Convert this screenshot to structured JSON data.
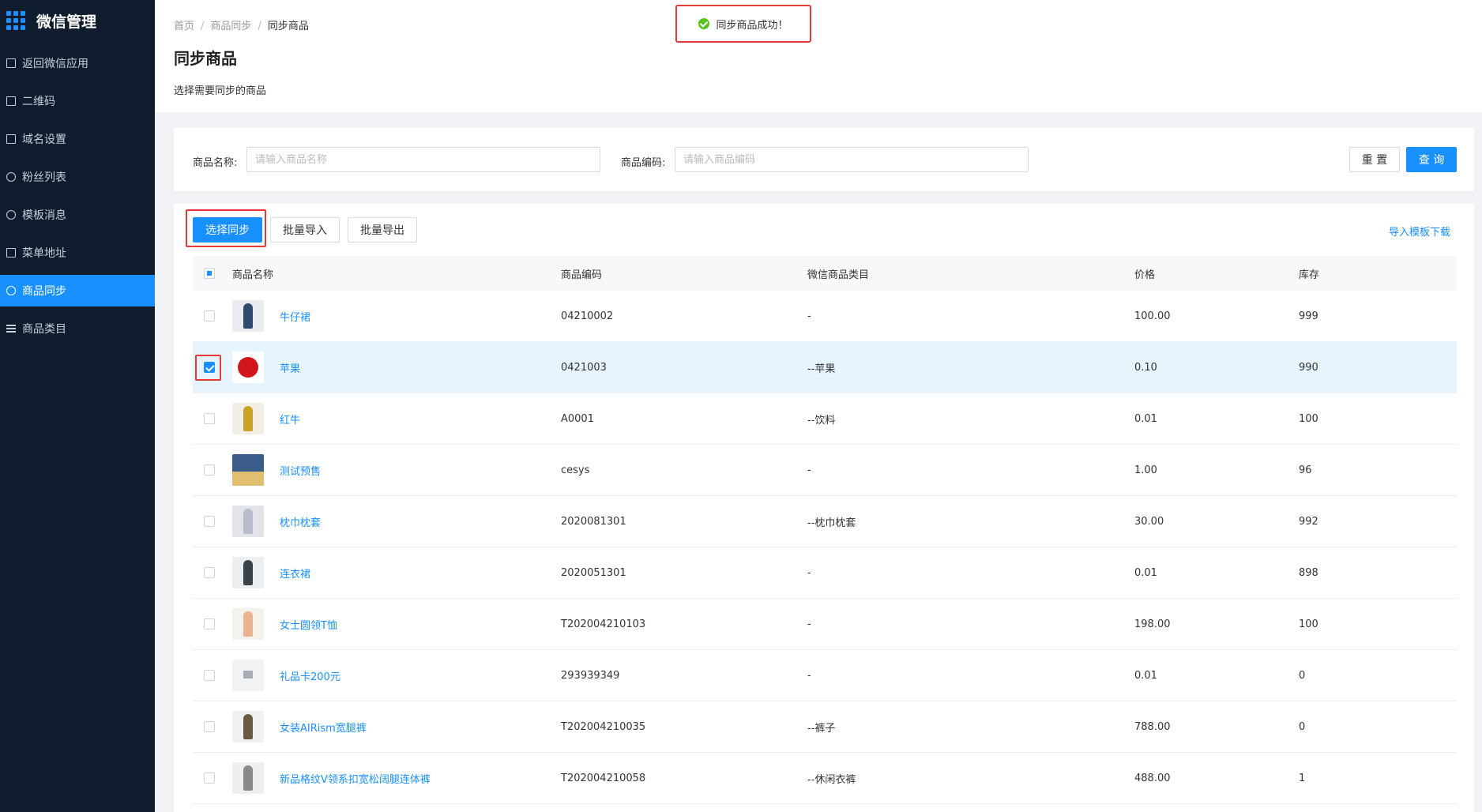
{
  "sidebar": {
    "brand_title": "微信管理",
    "items": [
      {
        "label": "返回微信应用",
        "icon": "return-icon"
      },
      {
        "label": "二维码",
        "icon": "qrcode-icon"
      },
      {
        "label": "域名设置",
        "icon": "domain-icon"
      },
      {
        "label": "粉丝列表",
        "icon": "refresh-icon"
      },
      {
        "label": "模板消息",
        "icon": "message-icon"
      },
      {
        "label": "菜单地址",
        "icon": "menu-check-icon"
      },
      {
        "label": "商品同步",
        "icon": "cloud-icon",
        "active": true
      },
      {
        "label": "商品类目",
        "icon": "list-icon"
      }
    ]
  },
  "header": {
    "breadcrumb": [
      "首页",
      "商品同步",
      "同步商品"
    ],
    "title": "同步商品",
    "description": "选择需要同步的商品"
  },
  "toast": {
    "message": "同步商品成功！"
  },
  "search": {
    "name_label": "商品名称:",
    "name_placeholder": "请输入商品名称",
    "code_label": "商品编码:",
    "code_placeholder": "请输入商品编码",
    "reset_label": "重 置",
    "query_label": "查 询"
  },
  "toolbar": {
    "sync_label": "选择同步",
    "import_label": "批量导入",
    "export_label": "批量导出",
    "download_label": "导入模板下载"
  },
  "table": {
    "headers": {
      "name": "商品名称",
      "code": "商品编码",
      "category": "微信商品类目",
      "price": "价格",
      "stock": "库存"
    },
    "rows": [
      {
        "name": "牛仔裙",
        "code": "04210002",
        "category": "-",
        "price": "100.00",
        "stock": "999",
        "checked": false,
        "thumb": "dress"
      },
      {
        "name": "苹果",
        "code": "0421003",
        "category": "--苹果",
        "price": "0.10",
        "stock": "990",
        "checked": true,
        "thumb": "apple"
      },
      {
        "name": "红牛",
        "code": "A0001",
        "category": "--饮料",
        "price": "0.01",
        "stock": "100",
        "checked": false,
        "thumb": "can"
      },
      {
        "name": "测试预售",
        "code": "cesys",
        "category": "-",
        "price": "1.00",
        "stock": "96",
        "checked": false,
        "thumb": "landscape"
      },
      {
        "name": "枕巾枕套",
        "code": "2020081301",
        "category": "--枕巾枕套",
        "price": "30.00",
        "stock": "992",
        "checked": false,
        "thumb": "pillow"
      },
      {
        "name": "连衣裙",
        "code": "2020051301",
        "category": "-",
        "price": "0.01",
        "stock": "898",
        "checked": false,
        "thumb": "dress2"
      },
      {
        "name": "女士圆领T恤",
        "code": "T202004210103",
        "category": "-",
        "price": "198.00",
        "stock": "100",
        "checked": false,
        "thumb": "tshirt"
      },
      {
        "name": "礼品卡200元",
        "code": "293939349",
        "category": "-",
        "price": "0.01",
        "stock": "0",
        "checked": false,
        "thumb": "placeholder"
      },
      {
        "name": "女装AIRism宽腿裤",
        "code": "T202004210035",
        "category": "--裤子",
        "price": "788.00",
        "stock": "0",
        "checked": false,
        "thumb": "pants"
      },
      {
        "name": "新品格纹V领系扣宽松阔腿连体裤",
        "code": "T202004210058",
        "category": "--休闲衣裤",
        "price": "488.00",
        "stock": "1",
        "checked": false,
        "thumb": "jumpsuit"
      }
    ]
  },
  "colors": {
    "sidebar_bg": "#0f1c2e",
    "accent": "#1890ff",
    "highlight": "#e53935",
    "success": "#52c41a",
    "selected_row": "#e6f4fd"
  }
}
